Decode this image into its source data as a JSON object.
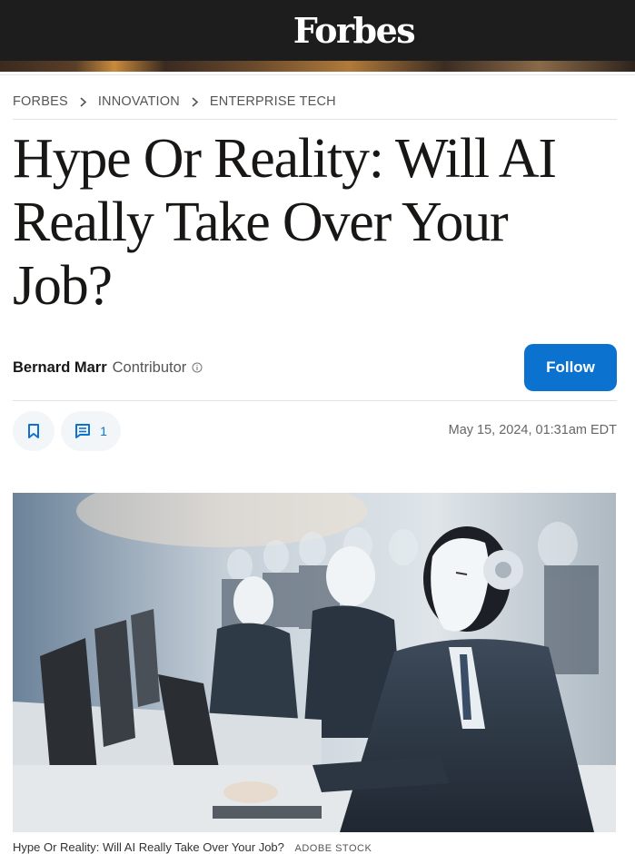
{
  "header": {
    "logo": "Forbes"
  },
  "breadcrumb": [
    "FORBES",
    "INNOVATION",
    "ENTERPRISE TECH"
  ],
  "article": {
    "title": "Hype Or Reality: Will AI Really Take Over Your Job?",
    "author": "Bernard Marr",
    "author_role": "Contributor",
    "follow_label": "Follow",
    "comment_count": "1",
    "timestamp": "May 15, 2024, 01:31am EDT",
    "image_caption": "Hype Or Reality: Will AI Really Take Over Your Job?",
    "image_credit": "ADOBE STOCK"
  },
  "icons": {
    "chevron": "chevron-right-icon",
    "info": "info-icon",
    "bookmark": "bookmark-icon",
    "comment": "comment-icon"
  },
  "colors": {
    "header_bg": "#1d1d1d",
    "accent": "#0b73cf",
    "pill_bg": "#f3f6f9"
  }
}
